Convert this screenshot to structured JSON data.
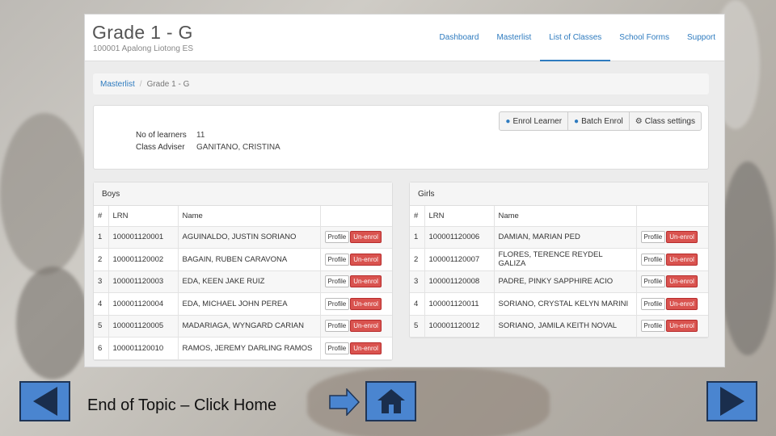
{
  "header": {
    "title": "Grade 1 - G",
    "subtitle": "100001 Apalong Liotong ES"
  },
  "nav": {
    "items": [
      {
        "label": "Dashboard"
      },
      {
        "label": "Masterlist"
      },
      {
        "label": "List of Classes"
      },
      {
        "label": "School Forms"
      },
      {
        "label": "Support"
      }
    ],
    "active": "List of Classes"
  },
  "breadcrumb": {
    "parent": "Masterlist",
    "separator": "/",
    "current": "Grade 1 - G"
  },
  "actions": {
    "enrol": "Enrol Learner",
    "batch": "Batch Enrol",
    "settings": "Class settings"
  },
  "class_info": {
    "learners_label": "No of learners",
    "learners_value": "11",
    "adviser_label": "Class Adviser",
    "adviser_value": "GANITANO, CRISTINA"
  },
  "table_headers": {
    "num": "#",
    "lrn": "LRN",
    "name": "Name"
  },
  "row_buttons": {
    "profile": "Profile",
    "unenrol": "Un-enrol"
  },
  "boys": {
    "title": "Boys",
    "rows": [
      {
        "num": "1",
        "lrn": "100001120001",
        "name": "AGUINALDO, JUSTIN SORIANO"
      },
      {
        "num": "2",
        "lrn": "100001120002",
        "name": "BAGAIN, RUBEN CARAVONA"
      },
      {
        "num": "3",
        "lrn": "100001120003",
        "name": "EDA, KEEN JAKE RUIZ"
      },
      {
        "num": "4",
        "lrn": "100001120004",
        "name": "EDA, MICHAEL JOHN PEREA"
      },
      {
        "num": "5",
        "lrn": "100001120005",
        "name": "MADARIAGA, WYNGARD CARIAN"
      },
      {
        "num": "6",
        "lrn": "100001120010",
        "name": "RAMOS, JEREMY DARLING RAMOS"
      }
    ]
  },
  "girls": {
    "title": "Girls",
    "rows": [
      {
        "num": "1",
        "lrn": "100001120006",
        "name": "DAMIAN, MARIAN PED"
      },
      {
        "num": "2",
        "lrn": "100001120007",
        "name": "FLORES, TERENCE REYDEL GALIZA"
      },
      {
        "num": "3",
        "lrn": "100001120008",
        "name": "PADRE, PINKY SAPPHIRE ACIO"
      },
      {
        "num": "4",
        "lrn": "100001120011",
        "name": "SORIANO, CRYSTAL KELYN MARINI"
      },
      {
        "num": "5",
        "lrn": "100001120012",
        "name": "SORIANO, JAMILA KEITH NOVAL"
      }
    ]
  },
  "slide": {
    "end_text": "End of Topic – Click Home",
    "prev_icon": "left-triangle-icon",
    "next_icon": "right-triangle-icon",
    "home_icon": "home-icon",
    "arrow_icon": "right-arrow-icon",
    "button_color": "#4a85d0"
  },
  "colors": {
    "link": "#2e7bbf",
    "danger": "#d9534f"
  }
}
